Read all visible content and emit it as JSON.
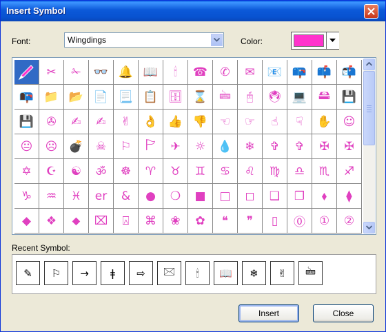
{
  "window": {
    "title": "Insert Symbol"
  },
  "font": {
    "label": "Font:",
    "value": "Wingdings"
  },
  "color": {
    "label": "Color:",
    "value": "#ff33cc"
  },
  "symbol_grid": {
    "selected_index": 0,
    "symbol_color": "#e040c0",
    "cells": [
      "✎",
      "✂",
      "✁",
      "👓",
      "🔔",
      "📖",
      "🕯",
      "☎",
      "✆",
      "✉",
      "📧",
      "📪",
      "📫",
      "📬",
      "📭",
      "📁",
      "📂",
      "📄",
      "📃",
      "📋",
      "🗄",
      "⌛",
      "🖮",
      "🖰",
      "🖲",
      "💻",
      "🖴",
      "💾",
      "💾",
      "✇",
      "✍",
      "✍",
      "✌",
      "👌",
      "👍",
      "👎",
      "☜",
      "☞",
      "☝",
      "☟",
      "✋",
      "☺",
      "😐",
      "☹",
      "💣",
      "☠",
      "⚐",
      "🏱",
      "✈",
      "☼",
      "💧",
      "❄",
      "✞",
      "✞",
      "✠",
      "✠",
      "✡",
      "☪",
      "☯",
      "ॐ",
      "☸",
      "♈",
      "♉",
      "♊",
      "♋",
      "♌",
      "♍",
      "♎",
      "♏",
      "♐",
      "♑",
      "♒",
      "♓",
      "er",
      "&",
      "●",
      "❍",
      "■",
      "□",
      "◻",
      "❑",
      "❒",
      "⬧",
      "⧫",
      "◆",
      "❖",
      "⬥",
      "⌧",
      "⍓",
      "⌘",
      "❀",
      "✿",
      "❝",
      "❞",
      "▯",
      "⓪",
      "①",
      "②"
    ]
  },
  "scrollbar": {
    "up_icon": "arrow-up",
    "down_icon": "arrow-down"
  },
  "recent": {
    "label": "Recent Symbol:",
    "symbols": [
      "✎",
      "⚐",
      "→",
      "ǂ",
      "⇨",
      "🖂",
      "🕯",
      "📖",
      "❄",
      "✌",
      "🖮"
    ]
  },
  "buttons": {
    "insert": "Insert",
    "close": "Close"
  }
}
